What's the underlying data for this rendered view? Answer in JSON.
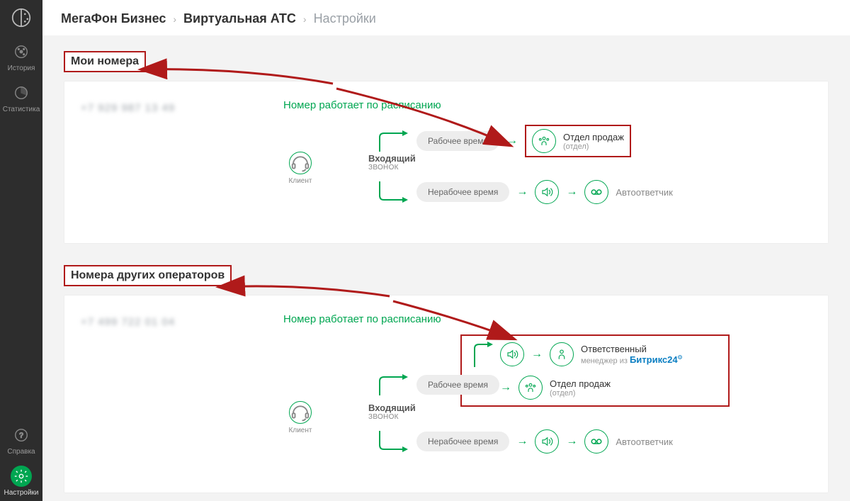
{
  "sidebar": {
    "items": [
      {
        "label": "История"
      },
      {
        "label": "Статистика"
      },
      {
        "label": "Справка"
      },
      {
        "label": "Настройки"
      }
    ]
  },
  "breadcrumb": {
    "l1": "МегаФон Бизнес",
    "l2": "Виртуальная АТС",
    "l3": "Настройки"
  },
  "section1": {
    "title": "Мои номера",
    "phone_blurred": "+7 929 987 13 49",
    "schedule_title": "Номер работает по расписанию",
    "client": "Клиент",
    "incoming_title": "Входящий",
    "incoming_sub": "звонок",
    "work_chip": "Рабочее время",
    "nonwork_chip": "Нерабочее время",
    "dept_name": "Отдел продаж",
    "dept_sub": "(отдел)",
    "answer": "Автоответчик"
  },
  "section2": {
    "title": "Номера других операторов",
    "phone_blurred": "+7 499 722 01 04",
    "schedule_title": "Номер работает по расписанию",
    "client": "Клиент",
    "incoming_title": "Входящий",
    "incoming_sub": "звонок",
    "work_chip": "Рабочее время",
    "nonwork_chip": "Нерабочее время",
    "dept_name": "Отдел продаж",
    "dept_sub": "(отдел)",
    "resp_name": "Ответственный",
    "resp_sub": "менеджер из",
    "bitrix": "Битрикс24",
    "answer": "Автоответчик"
  }
}
